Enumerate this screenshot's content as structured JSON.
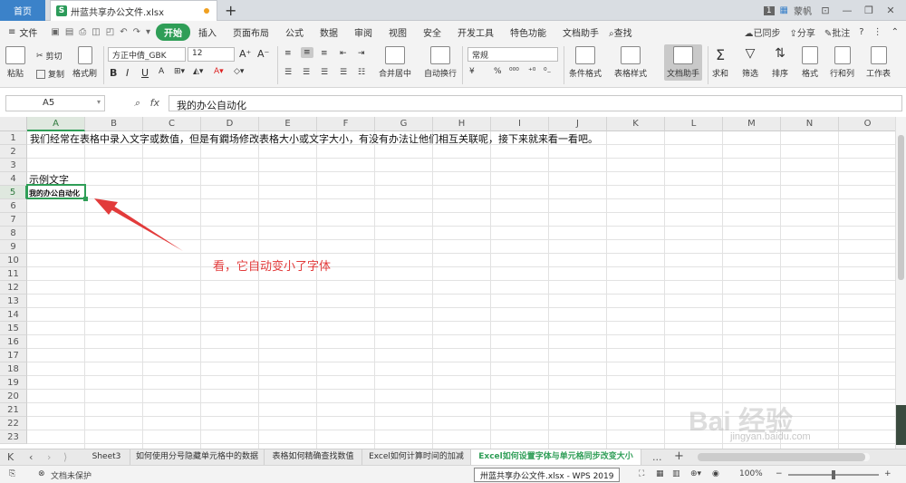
{
  "titlebar": {
    "home_tab": "首页",
    "doc_tab": "卅蓝共享办公文件.xlsx",
    "doc_icon_letter": "S",
    "new_tab": "+",
    "badge": "1",
    "user": "蒙帆"
  },
  "menubar": {
    "file": "文件",
    "items": [
      "开始",
      "插入",
      "页面布局",
      "公式",
      "数据",
      "审阅",
      "视图",
      "安全",
      "开发工具",
      "特色功能",
      "文档助手"
    ],
    "search": "查找",
    "sync": "已同步",
    "share": "分享",
    "comment": "批注",
    "help": "?"
  },
  "ribbon": {
    "paste": "粘贴",
    "cut": "剪切",
    "copy": "复制",
    "format_painter": "格式刷",
    "font_name": "方正中倩_GBK",
    "font_size": "12",
    "merge": "合并居中",
    "wrap": "自动换行",
    "number_format": "常规",
    "conditional": "条件格式",
    "table_style": "表格样式",
    "doc_helper": "文档助手",
    "sum": "求和",
    "filter": "筛选",
    "sort": "排序",
    "format": "格式",
    "rowcol": "行和列",
    "worksheet": "工作表",
    "bold": "B",
    "italic": "I",
    "underline": "U",
    "percent": "%",
    "currency": "¥"
  },
  "formula": {
    "cell_ref": "A5",
    "fx": "fx",
    "value": "我的办公自动化"
  },
  "columns": [
    "A",
    "B",
    "C",
    "D",
    "E",
    "F",
    "G",
    "H",
    "I",
    "J",
    "K",
    "L",
    "M",
    "N",
    "O"
  ],
  "rows": [
    "1",
    "2",
    "3",
    "4",
    "5",
    "6",
    "7",
    "8",
    "9",
    "10",
    "11",
    "12",
    "13",
    "14",
    "15",
    "16",
    "17",
    "18",
    "19",
    "20",
    "21",
    "22",
    "23"
  ],
  "cells": {
    "a1": "我们经常在表格中录入文字或数值，但是有鐗场修改表格大小或文字大小，有没有办法让他们相互关联呢，接下来就来看一看吧。",
    "a4": "示例文字",
    "a5": "我的办公自动化"
  },
  "annotation": "看，它自动变小了字体",
  "annotation_color": "#e23b3b",
  "sheets": [
    "Sheet3",
    "如何使用分号隐藏单元格中的数据",
    "表格如何精确查找数值",
    "Excel如何计算时间的加减",
    "Excel如何设置字体与单元格同步改变大小"
  ],
  "active_sheet_index": 4,
  "more_sheets": "...",
  "add_sheet": "+",
  "statusbar": {
    "protect": "文档未保护",
    "tooltip": "卅蓝共享办公文件.xlsx - WPS 2019",
    "zoom": "100%"
  },
  "watermark": "Bai 经验",
  "watermark_sub": "jingyan.baidu.com",
  "accent": "#2f9e57"
}
